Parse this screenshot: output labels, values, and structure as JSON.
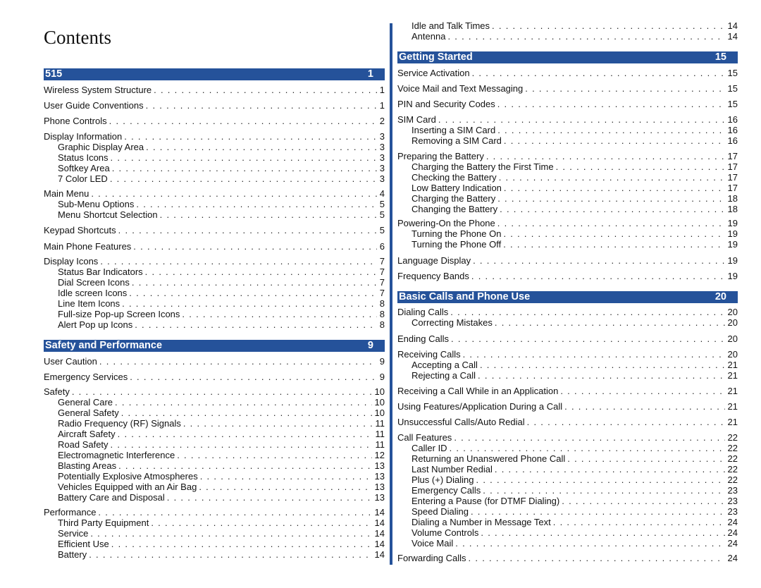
{
  "title": "Contents",
  "left_column": {
    "sections": [
      {
        "title": "515",
        "page": "1",
        "entries": [
          {
            "label": "Wireless System Structure",
            "page": "1",
            "level": 1
          },
          {
            "label": "User Guide Conventions",
            "page": "1",
            "level": 1
          },
          {
            "label": "Phone Controls",
            "page": "2",
            "level": 1
          },
          {
            "label": "Display Information",
            "page": "3",
            "level": 1
          },
          {
            "label": "Graphic Display Area",
            "page": "3",
            "level": 2
          },
          {
            "label": "Status Icons",
            "page": "3",
            "level": 2
          },
          {
            "label": "Softkey Area",
            "page": "3",
            "level": 2
          },
          {
            "label": "7 Color LED",
            "page": "3",
            "level": 2
          },
          {
            "label": "Main Menu",
            "page": "4",
            "level": 1
          },
          {
            "label": "Sub-Menu Options",
            "page": "5",
            "level": 2
          },
          {
            "label": "Menu Shortcut Selection",
            "page": "5",
            "level": 2
          },
          {
            "label": "Keypad Shortcuts",
            "page": "5",
            "level": 1
          },
          {
            "label": "Main Phone Features",
            "page": "6",
            "level": 1
          },
          {
            "label": "Display Icons",
            "page": "7",
            "level": 1
          },
          {
            "label": "Status Bar Indicators",
            "page": "7",
            "level": 2
          },
          {
            "label": "Dial Screen Icons",
            "page": "7",
            "level": 2
          },
          {
            "label": "Idle screen Icons",
            "page": "7",
            "level": 2
          },
          {
            "label": "Line Item Icons",
            "page": "8",
            "level": 2
          },
          {
            "label": "Full-size Pop-up Screen Icons",
            "page": "8",
            "level": 2
          },
          {
            "label": "Alert Pop up Icons",
            "page": "8",
            "level": 2
          }
        ]
      },
      {
        "title": "Safety and Performance",
        "page": "9",
        "entries": [
          {
            "label": "User Caution",
            "page": "9",
            "level": 1
          },
          {
            "label": "Emergency Services",
            "page": "9",
            "level": 1
          },
          {
            "label": "Safety",
            "page": "10",
            "level": 1
          },
          {
            "label": "General Care",
            "page": "10",
            "level": 2
          },
          {
            "label": "General Safety",
            "page": "10",
            "level": 2
          },
          {
            "label": "Radio Frequency (RF) Signals",
            "page": "11",
            "level": 2
          },
          {
            "label": "Aircraft Safety",
            "page": "11",
            "level": 2
          },
          {
            "label": "Road Safety",
            "page": "11",
            "level": 2
          },
          {
            "label": "Electromagnetic Interference",
            "page": "12",
            "level": 2
          },
          {
            "label": "Blasting Areas",
            "page": "13",
            "level": 2
          },
          {
            "label": "Potentially Explosive Atmospheres",
            "page": "13",
            "level": 2
          },
          {
            "label": "Vehicles Equipped with an Air Bag",
            "page": "13",
            "level": 2
          },
          {
            "label": "Battery Care and Disposal",
            "page": "13",
            "level": 2
          },
          {
            "label": "Performance",
            "page": "14",
            "level": 1
          },
          {
            "label": "Third Party Equipment",
            "page": "14",
            "level": 2
          },
          {
            "label": "Service",
            "page": "14",
            "level": 2
          },
          {
            "label": "Efficient Use",
            "page": "14",
            "level": 2
          },
          {
            "label": "Battery",
            "page": "14",
            "level": 2
          }
        ]
      }
    ]
  },
  "right_column": {
    "continued_entries": [
      {
        "label": "Idle and Talk Times",
        "page": "14",
        "level": 2
      },
      {
        "label": "Antenna",
        "page": "14",
        "level": 2
      }
    ],
    "sections": [
      {
        "title": "Getting Started",
        "page": "15",
        "entries": [
          {
            "label": "Service Activation",
            "page": "15",
            "level": 1
          },
          {
            "label": "Voice Mail and Text Messaging",
            "page": "15",
            "level": 1
          },
          {
            "label": "PIN and Security Codes",
            "page": "15",
            "level": 1
          },
          {
            "label": "SIM Card",
            "page": "16",
            "level": 1
          },
          {
            "label": "Inserting a SIM Card",
            "page": "16",
            "level": 2
          },
          {
            "label": "Removing a SIM Card",
            "page": "16",
            "level": 2
          },
          {
            "label": "Preparing the Battery",
            "page": "17",
            "level": 1
          },
          {
            "label": "Charging the Battery the First Time",
            "page": "17",
            "level": 2
          },
          {
            "label": "Checking the Battery",
            "page": "17",
            "level": 2
          },
          {
            "label": "Low Battery Indication",
            "page": "17",
            "level": 2
          },
          {
            "label": "Charging the Battery",
            "page": "18",
            "level": 2
          },
          {
            "label": "Changing the Battery",
            "page": "18",
            "level": 2
          },
          {
            "label": "Powering-On the Phone",
            "page": "19",
            "level": 1
          },
          {
            "label": "Turning the Phone On",
            "page": "19",
            "level": 2
          },
          {
            "label": "Turning the Phone Off",
            "page": "19",
            "level": 2
          },
          {
            "label": "Language Display",
            "page": "19",
            "level": 1
          },
          {
            "label": "Frequency Bands",
            "page": "19",
            "level": 1
          }
        ]
      },
      {
        "title": "Basic Calls and Phone Use",
        "page": "20",
        "entries": [
          {
            "label": "Dialing Calls",
            "page": "20",
            "level": 1
          },
          {
            "label": "Correcting Mistakes",
            "page": "20",
            "level": 2
          },
          {
            "label": "Ending Calls",
            "page": "20",
            "level": 1
          },
          {
            "label": "Receiving Calls",
            "page": "20",
            "level": 1
          },
          {
            "label": "Accepting a Call",
            "page": "21",
            "level": 2
          },
          {
            "label": "Rejecting a Call",
            "page": "21",
            "level": 2
          },
          {
            "label": "Receiving a Call While in an Application",
            "page": "21",
            "level": 1
          },
          {
            "label": "Using Features/Application During a Call",
            "page": "21",
            "level": 1
          },
          {
            "label": "Unsuccessful Calls/Auto Redial",
            "page": "21",
            "level": 1
          },
          {
            "label": "Call Features",
            "page": "22",
            "level": 1
          },
          {
            "label": "Caller ID",
            "page": "22",
            "level": 2
          },
          {
            "label": "Returning an Unanswered Phone Call",
            "page": "22",
            "level": 2
          },
          {
            "label": "Last Number Redial",
            "page": "22",
            "level": 2
          },
          {
            "label": "Plus (+) Dialing",
            "page": "22",
            "level": 2
          },
          {
            "label": "Emergency Calls",
            "page": "23",
            "level": 2
          },
          {
            "label": "Entering a Pause (for DTMF Dialing)",
            "page": "23",
            "level": 2
          },
          {
            "label": "Speed Dialing",
            "page": "23",
            "level": 2
          },
          {
            "label": "Dialing a Number in Message Text",
            "page": "24",
            "level": 2
          },
          {
            "label": "Volume Controls",
            "page": "24",
            "level": 2
          },
          {
            "label": "Voice Mail",
            "page": "24",
            "level": 2
          },
          {
            "label": "Forwarding Calls",
            "page": "24",
            "level": 1
          }
        ]
      }
    ]
  },
  "colors": {
    "section_bar": "#25529a",
    "section_text": "#ffffff",
    "body_text": "#111111"
  }
}
